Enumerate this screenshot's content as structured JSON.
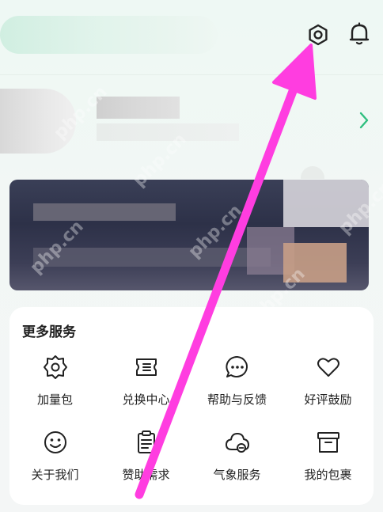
{
  "header": {
    "settings_icon": "gear-hexagon-icon",
    "notification_icon": "bell-icon"
  },
  "profile": {
    "chevron_icon": "chevron-right-icon",
    "accent_color": "#2fbf7f"
  },
  "services": {
    "title": "更多服务",
    "items": [
      {
        "label": "加量包",
        "icon": "gear-hexagon-icon"
      },
      {
        "label": "兑换中心",
        "icon": "ticket-icon"
      },
      {
        "label": "帮助与反馈",
        "icon": "chat-bubble-icon"
      },
      {
        "label": "好评鼓励",
        "icon": "heart-icon"
      },
      {
        "label": "关于我们",
        "icon": "smiley-icon"
      },
      {
        "label": "赞助需求",
        "icon": "clipboard-icon"
      },
      {
        "label": "气象服务",
        "icon": "cloud-icon"
      },
      {
        "label": "我的包裹",
        "icon": "box-icon"
      }
    ]
  },
  "annotation": {
    "arrow_color": "#ff3de0"
  },
  "watermark": "php.cn"
}
